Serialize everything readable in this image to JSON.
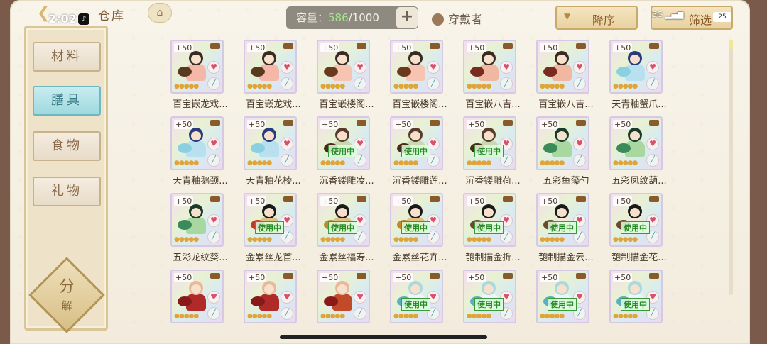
{
  "status_bar": {
    "time": "2:02",
    "battery": "25",
    "signal": "5G"
  },
  "header": {
    "title": "仓库",
    "capacity_label": "容量：",
    "capacity_current": "586",
    "capacity_max": "/1000",
    "wearer_label": "穿戴者",
    "sort_label": "降序",
    "filter_label": "筛选"
  },
  "sidebar": {
    "tabs": [
      {
        "label": "材料",
        "active": false
      },
      {
        "label": "膳具",
        "active": true
      },
      {
        "label": "食物",
        "active": false
      },
      {
        "label": "礼物",
        "active": false
      }
    ],
    "decompose_top": "分",
    "decompose_bottom": "解"
  },
  "grid": {
    "level": "+50",
    "inuse_label": "使用中",
    "items": [
      {
        "name": "百宝嵌龙戏...",
        "inuse": false,
        "hair": "#3a2a24",
        "color": "#f4b7a8",
        "prop": "#5a3a1e"
      },
      {
        "name": "百宝嵌龙戏...",
        "inuse": false,
        "hair": "#3a2a24",
        "color": "#f4b7a8",
        "prop": "#5a3a1e"
      },
      {
        "name": "百宝嵌楼阁...",
        "inuse": false,
        "hair": "#3a2a24",
        "color": "#f6c4b0",
        "prop": "#6a3a1e"
      },
      {
        "name": "百宝嵌楼阁...",
        "inuse": false,
        "hair": "#3a2a24",
        "color": "#f6c4b0",
        "prop": "#6a3a1e"
      },
      {
        "name": "百宝嵌八吉...",
        "inuse": false,
        "hair": "#3a2a24",
        "color": "#f0b8a0",
        "prop": "#7a2a1e"
      },
      {
        "name": "百宝嵌八吉...",
        "inuse": false,
        "hair": "#3a2a24",
        "color": "#f0b8a0",
        "prop": "#7a2a1e"
      },
      {
        "name": "天青釉蟹爪...",
        "inuse": false,
        "hair": "#2a3a7a",
        "color": "#b8e0ee",
        "prop": "#8ad0e0"
      },
      {
        "name": "天青釉鹅颈...",
        "inuse": false,
        "hair": "#2a3a7a",
        "color": "#b8e0ee",
        "prop": "#8ad0e0"
      },
      {
        "name": "天青釉花棱...",
        "inuse": false,
        "hair": "#2a3a7a",
        "color": "#b8e0ee",
        "prop": "#8ad0e0"
      },
      {
        "name": "沉香镂雕凌...",
        "inuse": true,
        "hair": "#5a3a2a",
        "color": "#c8d8b0",
        "prop": "#4a2a1a"
      },
      {
        "name": "沉香镂雕莲...",
        "inuse": true,
        "hair": "#5a3a2a",
        "color": "#c8d8b0",
        "prop": "#4a2a1a"
      },
      {
        "name": "沉香镂雕荷...",
        "inuse": true,
        "hair": "#5a3a2a",
        "color": "#c8d8b0",
        "prop": "#4a2a1a"
      },
      {
        "name": "五彩鱼藻勺",
        "inuse": false,
        "hair": "#1a3a2a",
        "color": "#a8d8a0",
        "prop": "#3a8a5a"
      },
      {
        "name": "五彩凤纹葫...",
        "inuse": false,
        "hair": "#1a3a2a",
        "color": "#a8d8a0",
        "prop": "#3a8a5a"
      },
      {
        "name": "五彩龙纹葵...",
        "inuse": false,
        "hair": "#1a3a2a",
        "color": "#a8d8a0",
        "prop": "#3a8a5a"
      },
      {
        "name": "金累丝龙首...",
        "inuse": true,
        "hair": "#1a1a1a",
        "color": "#e0c080",
        "prop": "#c03a2a"
      },
      {
        "name": "金累丝福寿...",
        "inuse": true,
        "hair": "#1a1a1a",
        "color": "#e0c080",
        "prop": "#c08a2a"
      },
      {
        "name": "金累丝花卉...",
        "inuse": true,
        "hair": "#1a1a1a",
        "color": "#e0c080",
        "prop": "#c08a2a"
      },
      {
        "name": "匏制描金折...",
        "inuse": true,
        "hair": "#1a1a1a",
        "color": "#f2e8d8",
        "prop": "#6a4a2a"
      },
      {
        "name": "匏制描金云...",
        "inuse": true,
        "hair": "#1a1a1a",
        "color": "#f2e8d8",
        "prop": "#6a4a2a"
      },
      {
        "name": "匏制描金花...",
        "inuse": true,
        "hair": "#1a1a1a",
        "color": "#f2e8d8",
        "prop": "#6a4a2a"
      },
      {
        "name": "",
        "inuse": false,
        "hair": "#e8b89a",
        "color": "#b02a2a",
        "prop": "#8a1a1a"
      },
      {
        "name": "",
        "inuse": false,
        "hair": "#e8b89a",
        "color": "#b02a2a",
        "prop": "#8a1a1a"
      },
      {
        "name": "",
        "inuse": false,
        "hair": "#e8b89a",
        "color": "#c04a2a",
        "prop": "#8a1a1a"
      },
      {
        "name": "",
        "inuse": true,
        "hair": "#a8d8e0",
        "color": "#f0f4f8",
        "prop": "#5ab0c0"
      },
      {
        "name": "",
        "inuse": true,
        "hair": "#a8d8e0",
        "color": "#f0f4f8",
        "prop": "#5ab0c0"
      },
      {
        "name": "",
        "inuse": true,
        "hair": "#a8d8e0",
        "color": "#f0f4f8",
        "prop": "#5ab0c0"
      },
      {
        "name": "",
        "inuse": true,
        "hair": "#a8d8e0",
        "color": "#f0f4f8",
        "prop": "#5ab0c0"
      }
    ]
  }
}
